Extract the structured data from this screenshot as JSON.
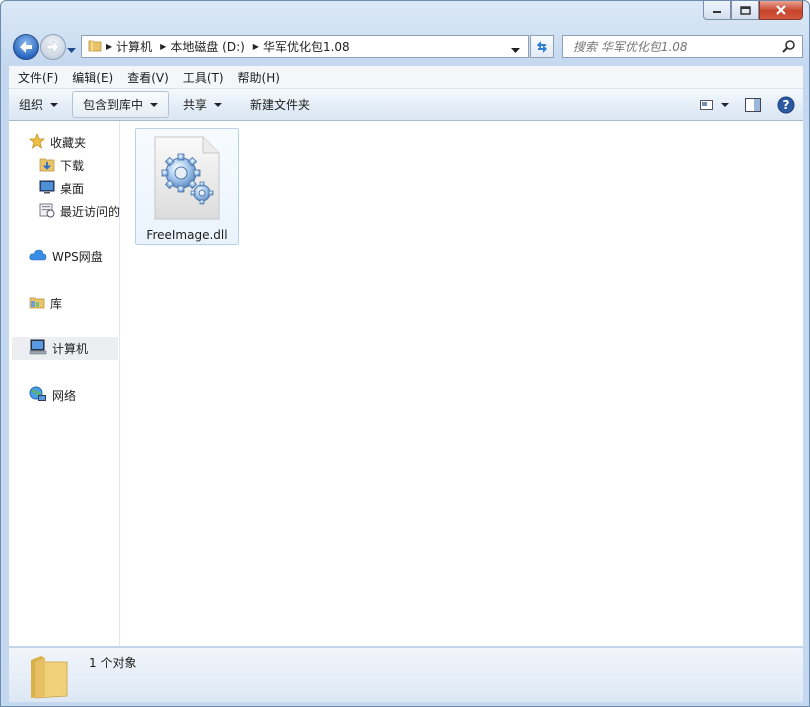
{
  "window": {
    "caption": {
      "minimize_icon": "minimize-icon",
      "maximize_icon": "maximize-icon",
      "close_icon": "close-icon"
    }
  },
  "address": {
    "breadcrumbs": [
      "计算机",
      "本地磁盘 (D:)",
      "华军优化包1.08"
    ]
  },
  "search": {
    "placeholder": "搜索 华军优化包1.08"
  },
  "menu": [
    "文件(F)",
    "编辑(E)",
    "查看(V)",
    "工具(T)",
    "帮助(H)"
  ],
  "toolbar": {
    "organize": "组织",
    "include_library": "包含到库中",
    "share": "共享",
    "new_folder": "新建文件夹"
  },
  "navpane": {
    "favorites": "收藏夹",
    "downloads": "下载",
    "desktop": "桌面",
    "recent": "最近访问的",
    "wps": "WPS网盘",
    "library": "库",
    "computer": "计算机",
    "network": "网络"
  },
  "files": [
    {
      "name": "FreeImage.dll",
      "icon": "dll-gear-icon"
    }
  ],
  "status": {
    "count_text": "1 个对象"
  },
  "colors": {
    "accent": "#2a67bf",
    "selection": "#eaf3fc",
    "close": "#c7442b"
  }
}
